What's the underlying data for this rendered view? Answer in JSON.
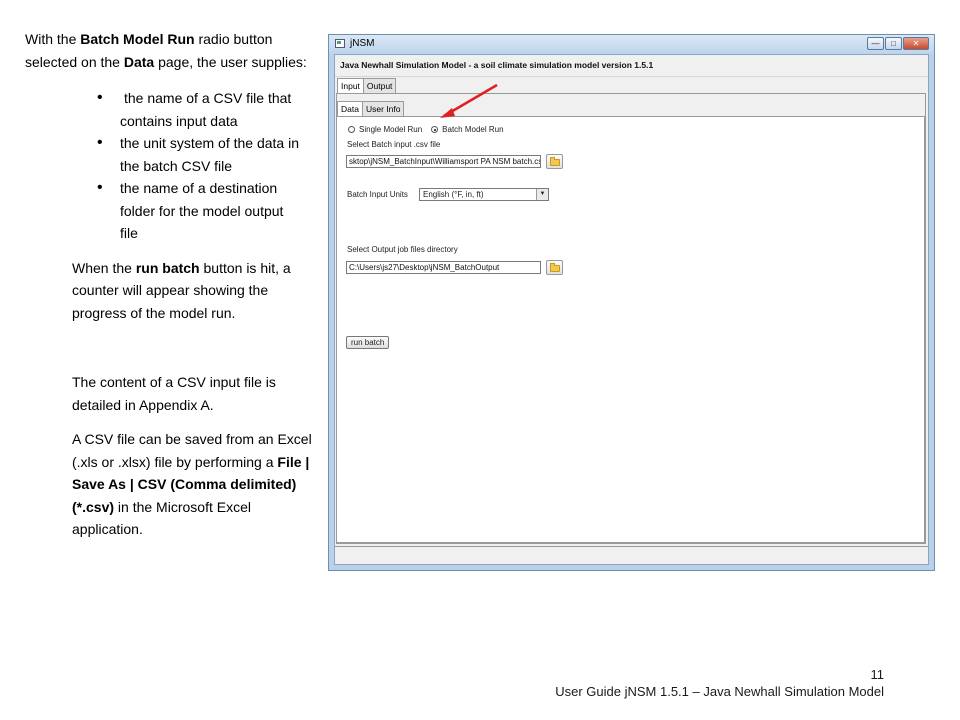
{
  "guide": {
    "intro": [
      {
        "text": "With the ",
        "bold": false
      },
      {
        "text": "Batch Model Run",
        "bold": true
      },
      {
        "text": " radio button selected on the ",
        "bold": false
      },
      {
        "text": "Data",
        "bold": true
      },
      {
        "text": " page, the user supplies:",
        "bold": false
      }
    ],
    "bullets": [
      [
        "the name of a CSV file that",
        "contains input data"
      ],
      [
        "the unit system of the data in",
        "the batch CSV file"
      ],
      [
        "the name of a destination",
        "folder for the model output",
        "file"
      ]
    ],
    "run_batch_para": [
      {
        "text": "When the ",
        "bold": false
      },
      {
        "text": "run batch",
        "bold": true
      },
      {
        "text": " button is hit, a counter will appear showing the progress of the model run.",
        "bold": false
      }
    ],
    "appendix_para": "The content of a CSV input file is detailed in Appendix A.",
    "excel_para": [
      {
        "text": "A CSV file can be saved from an Excel (.xls or .xlsx) file by performing a ",
        "bold": false
      },
      {
        "text": "File | Save As | CSV (Comma delimited) (*.csv)",
        "bold": true
      },
      {
        "text": " in the Microsoft Excel application.",
        "bold": false
      }
    ]
  },
  "footer": {
    "page_number": "11",
    "title": "User Guide jNSM 1.5.1 – Java Newhall Simulation Model"
  },
  "window": {
    "title": "jNSM",
    "app_title": "Java Newhall Simulation Model - a soil climate simulation model    version 1.5.1",
    "outer_tabs": [
      "Input",
      "Output"
    ],
    "inner_tabs": [
      "Data",
      "User Info"
    ],
    "radio_single": "Single Model Run",
    "radio_batch": "Batch Model Run",
    "selected_run_mode": "Batch Model Run",
    "batch_file_label": "Select Batch input .csv file",
    "batch_file_value": "sktop\\jNSM_BatchInput\\Williamsport PA NSM batch.csv",
    "units_label": "Batch Input Units",
    "units_value": "English (°F, in, ft)",
    "output_dir_label": "Select Output job files directory",
    "output_dir_value": "C:\\Users\\js27\\Desktop\\jNSM_BatchOutput",
    "run_batch_button": "run batch"
  },
  "colors": {
    "annotation_arrow": "#e02020",
    "window_frame": "#b9d1ea"
  }
}
